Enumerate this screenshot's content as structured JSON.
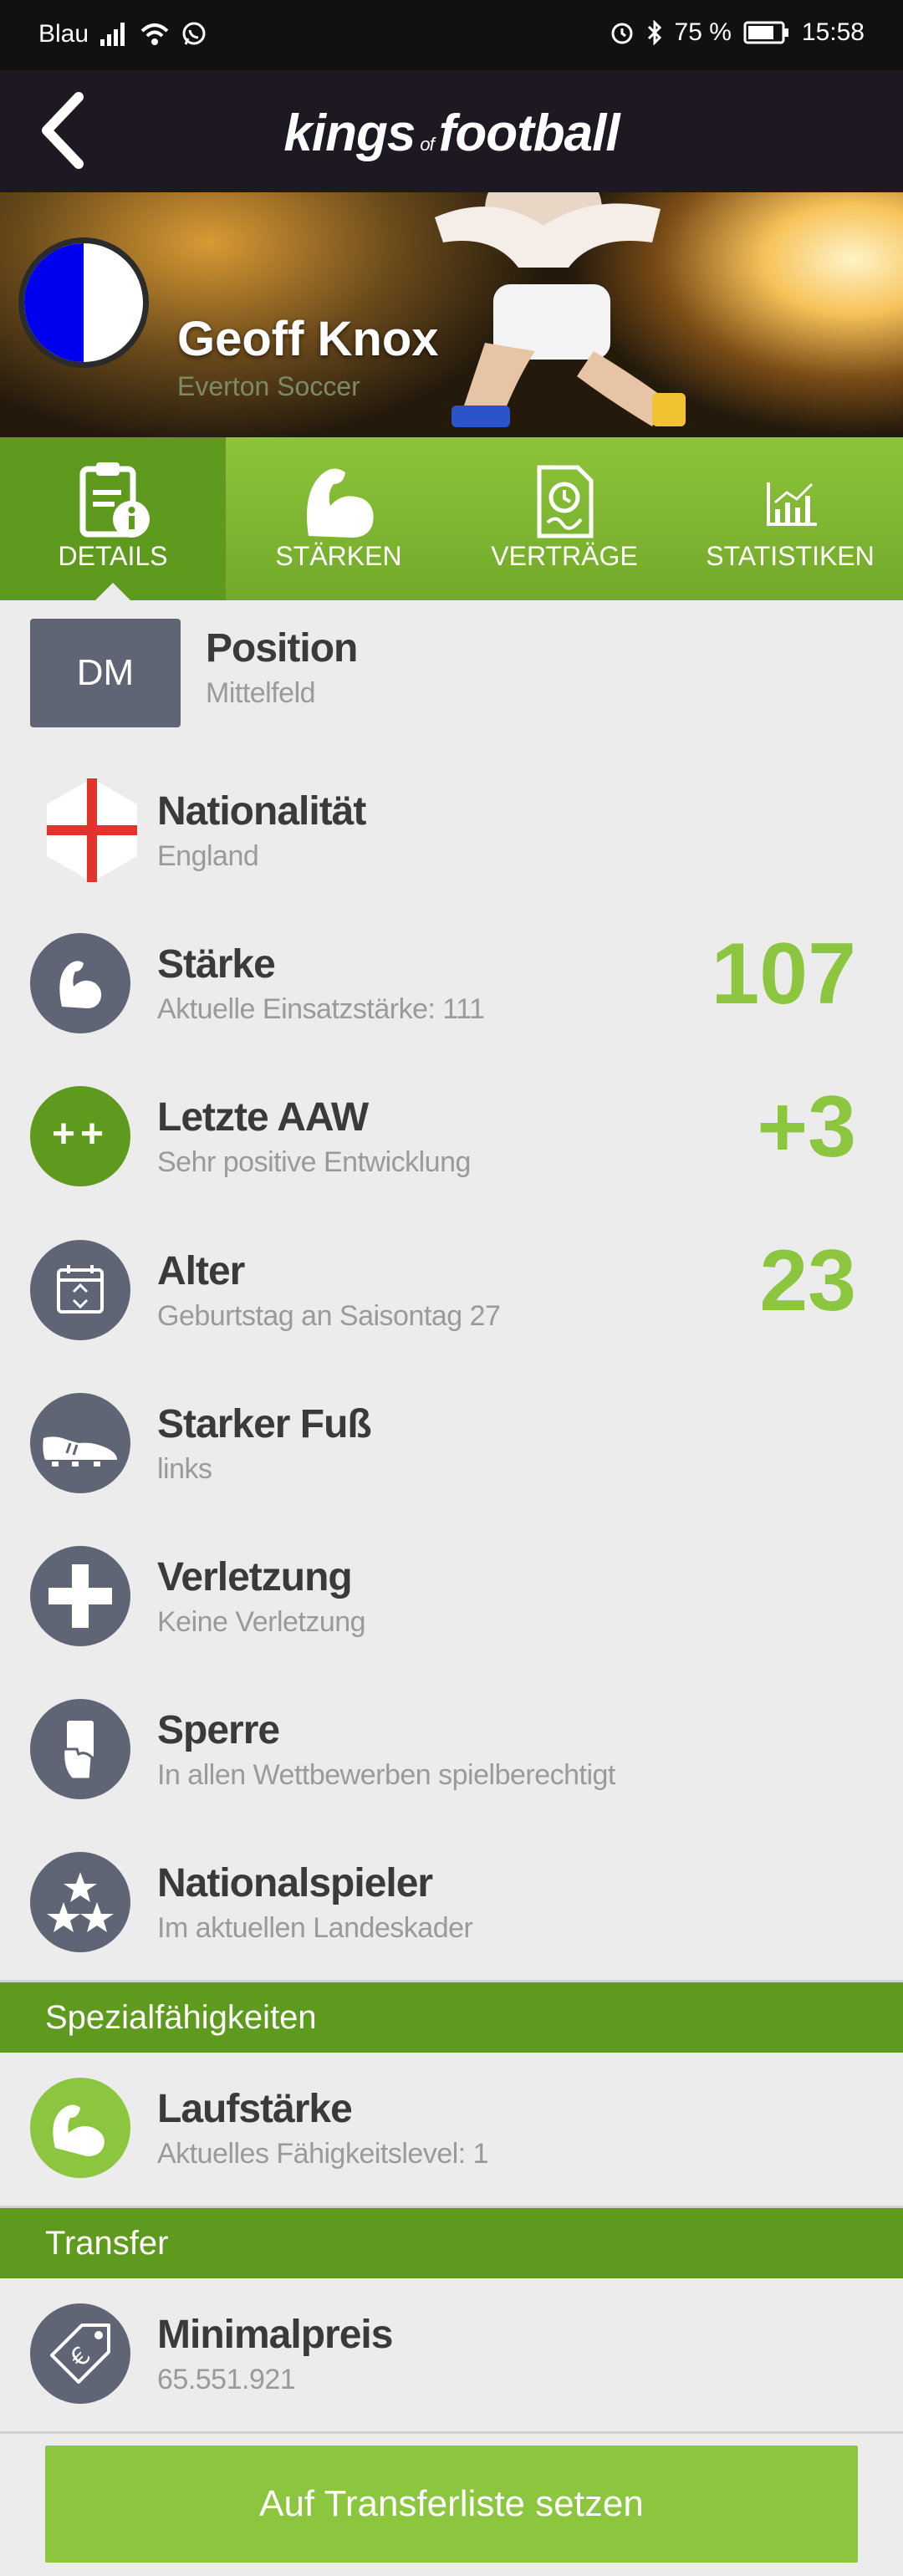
{
  "status_bar": {
    "carrier": "Blau",
    "battery": "75 %",
    "time": "15:58"
  },
  "app_bar": {
    "logo_kings": "kings",
    "logo_of": "of",
    "logo_football": "football"
  },
  "player": {
    "name": "Geoff Knox",
    "club": "Everton Soccer"
  },
  "tabs": [
    {
      "label": "DETAILS",
      "icon": "document-info-icon",
      "active": true
    },
    {
      "label": "STÄRKEN",
      "icon": "muscle-arm-icon",
      "active": false
    },
    {
      "label": "VERTRÄGE",
      "icon": "contract-icon",
      "active": false
    },
    {
      "label": "STATISTIKEN",
      "icon": "chart-icon",
      "active": false
    }
  ],
  "details": {
    "position": {
      "badge": "DM",
      "title": "Position",
      "sub": "Mittelfeld"
    },
    "nationality": {
      "title": "Nationalität",
      "sub": "England"
    },
    "strength": {
      "title": "Stärke",
      "sub": "Aktuelle Einsatzstärke: 111",
      "value": "107"
    },
    "last_aaw": {
      "title": "Letzte AAW",
      "sub": "Sehr positive Entwicklung",
      "value": "+3",
      "icon_text": "++"
    },
    "age": {
      "title": "Alter",
      "sub": "Geburtstag an Saisontag 27",
      "value": "23"
    },
    "foot": {
      "title": "Starker Fuß",
      "sub": "links"
    },
    "injury": {
      "title": "Verletzung",
      "sub": "Keine Verletzung"
    },
    "suspension": {
      "title": "Sperre",
      "sub": "In allen Wettbewerben spielberechtigt"
    },
    "national_player": {
      "title": "Nationalspieler",
      "sub": "Im aktuellen Landeskader"
    }
  },
  "special_section": {
    "header": "Spezialfähigkeiten",
    "stamina": {
      "title": "Laufstärke",
      "sub": "Aktuelles Fähigkeitslevel: 1"
    }
  },
  "transfer_section": {
    "header": "Transfer",
    "min_price": {
      "title": "Minimalpreis",
      "sub": "65.551.921"
    },
    "button": "Auf Transferliste setzen"
  },
  "colors": {
    "accent_green": "#8cc63f",
    "dark_green": "#5e9a1e",
    "icon_gray": "#5f6575",
    "club_blue": "#0000ee"
  }
}
